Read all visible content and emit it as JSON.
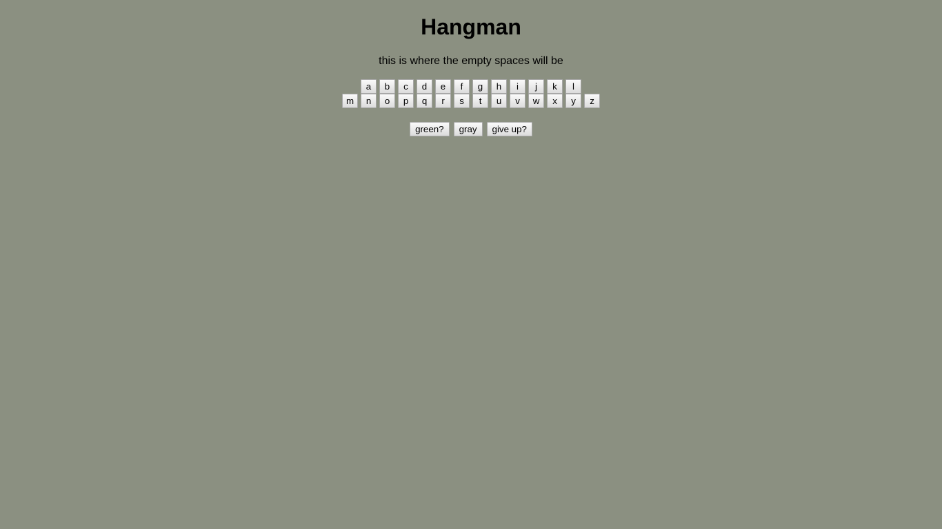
{
  "title": "Hangman",
  "word_placeholder": "this is where the empty spaces will be",
  "letters_row1": [
    "a",
    "b",
    "c",
    "d",
    "e",
    "f",
    "g",
    "h",
    "i",
    "j",
    "k",
    "l"
  ],
  "letters_row2": [
    "m",
    "n",
    "o",
    "p",
    "q",
    "r",
    "s",
    "t",
    "u",
    "v",
    "w",
    "x",
    "y",
    "z"
  ],
  "controls": {
    "green_label": "green?",
    "gray_label": "gray",
    "give_up_label": "give up?"
  },
  "colors": {
    "background": "#8b9081"
  }
}
